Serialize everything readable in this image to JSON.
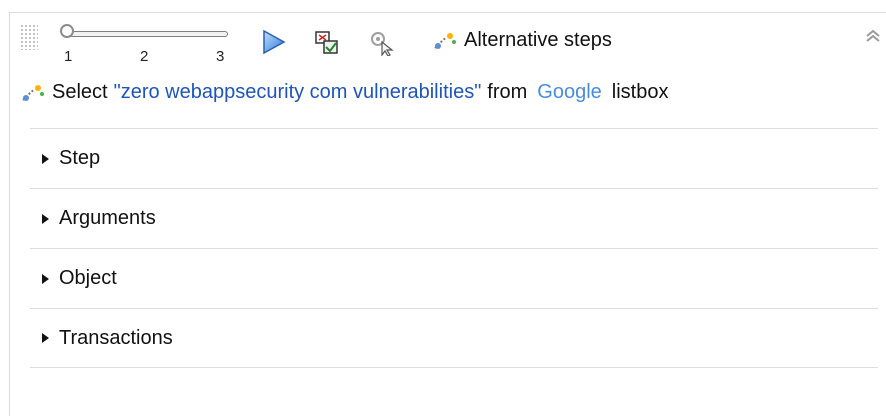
{
  "toolbar": {
    "slider": {
      "ticks": [
        "1",
        "2",
        "3"
      ],
      "value": "1"
    },
    "alternative_steps_label": "Alternative steps",
    "icons": [
      "drag-handle-icon",
      "play-icon",
      "checkpoint-icon",
      "pointer-icon",
      "alternative-steps-icon",
      "collapse-chevron-icon"
    ]
  },
  "step": {
    "prefix": "Select",
    "value": "\"zero webappsecurity com vulnerabilities\"",
    "from_word": "from",
    "object_link": "Google",
    "object_type": "listbox"
  },
  "sections": [
    {
      "label": "Step"
    },
    {
      "label": "Arguments"
    },
    {
      "label": "Object"
    },
    {
      "label": "Transactions"
    }
  ],
  "colors": {
    "accent": "#1f55b6",
    "link": "#4a8cdb",
    "border": "#dcdcdc"
  }
}
